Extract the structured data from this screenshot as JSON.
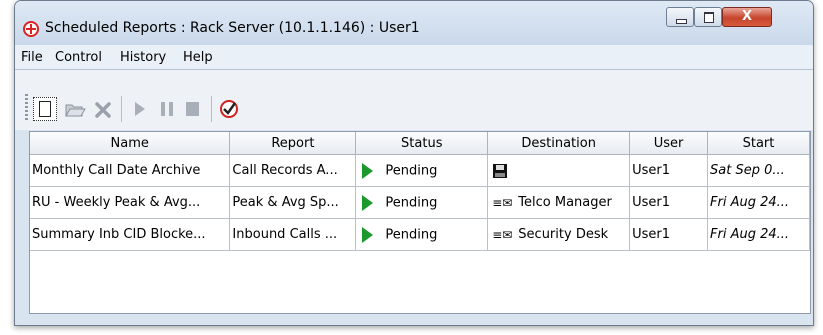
{
  "window": {
    "title": "Scheduled Reports : Rack Server (10.1.1.146) : User1",
    "close_label": "X"
  },
  "menu": [
    "File",
    "Control",
    "History",
    "Help"
  ],
  "toolbar": {
    "icons": [
      "new-report-icon",
      "open-folder-icon",
      "delete-icon",
      "play-icon",
      "pause-icon",
      "stop-icon",
      "check-icon"
    ]
  },
  "table": {
    "columns": [
      "Name",
      "Report",
      "Status",
      "Destination",
      "User",
      "Start"
    ],
    "rows": [
      {
        "name": "Monthly Call Date Archive",
        "report": "Call Records A...",
        "status": "Pending",
        "destination_icon": "floppy-disk-icon",
        "destination": "",
        "user": "User1",
        "start": "Sat Sep 0..."
      },
      {
        "name": "RU - Weekly Peak & Avg...",
        "report": "Peak & Avg Sp...",
        "status": "Pending",
        "destination_icon": "email-icon",
        "destination": "Telco Manager",
        "user": "User1",
        "start": "Fri Aug 24..."
      },
      {
        "name": "Summary Inb CID Blocke...",
        "report": "Inbound Calls ...",
        "status": "Pending",
        "destination_icon": "email-icon",
        "destination": "Security Desk",
        "user": "User1",
        "start": "Fri Aug 24..."
      }
    ]
  },
  "colors": {
    "play_green": "#1a9a2a",
    "close_red": "#c6452c",
    "check_red": "#d21f1f"
  }
}
